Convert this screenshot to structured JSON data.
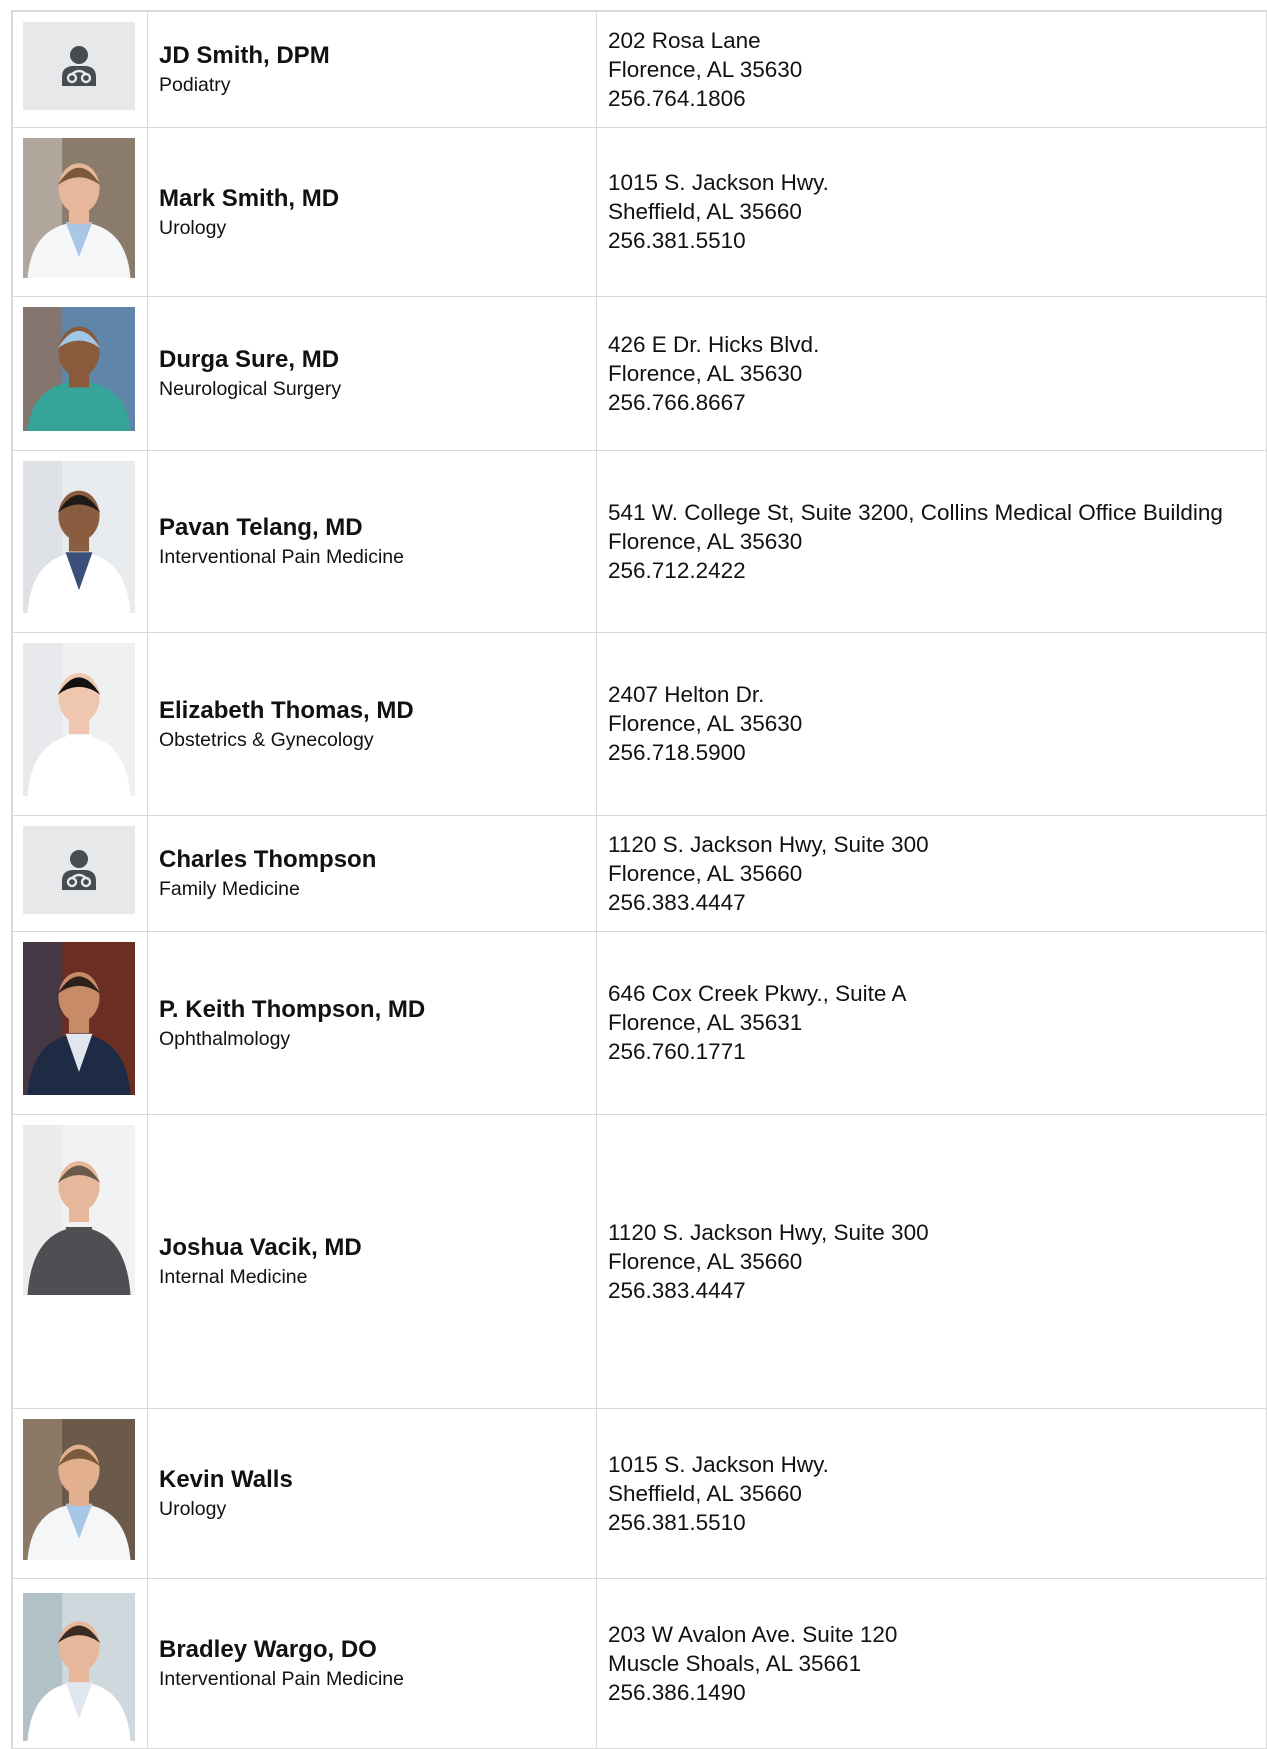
{
  "doctors": [
    {
      "name": "JD Smith, DPM",
      "specialty": "Podiatry",
      "address": "202 Rosa Lane",
      "city": "Florence, AL 35630",
      "phone": "256.764.1806",
      "photo": "placeholder-doctor-icon"
    },
    {
      "name": "Mark Smith, MD",
      "specialty": "Urology",
      "address": "1015 S. Jackson Hwy.",
      "city": "Sheffield, AL 35660",
      "phone": "256.381.5510",
      "photo": "portrait"
    },
    {
      "name": "Durga Sure, MD",
      "specialty": "Neurological Surgery",
      "address": "426 E Dr. Hicks Blvd.",
      "city": "Florence, AL 35630",
      "phone": "256.766.8667",
      "photo": "portrait"
    },
    {
      "name": "Pavan Telang, MD",
      "specialty": "Interventional Pain Medicine",
      "address": "541 W. College St, Suite 3200, Collins Medical Office Building",
      "city": "Florence, AL 35630",
      "phone": "256.712.2422",
      "photo": "portrait"
    },
    {
      "name": "Elizabeth Thomas, MD",
      "specialty": "Obstetrics & Gynecology",
      "address": "2407 Helton Dr.",
      "city": "Florence, AL 35630",
      "phone": "256.718.5900",
      "photo": "portrait"
    },
    {
      "name": "Charles Thompson",
      "specialty": "Family Medicine",
      "address": "1120 S. Jackson Hwy, Suite 300",
      "city": "Florence, AL 35660",
      "phone": "256.383.4447",
      "photo": "placeholder-doctor-icon"
    },
    {
      "name": "P. Keith Thompson, MD",
      "specialty": "Ophthalmology",
      "address": "646 Cox Creek Pkwy., Suite A",
      "city": "Florence, AL 35631",
      "phone": "256.760.1771",
      "photo": "portrait"
    },
    {
      "name": "Joshua Vacik, MD",
      "specialty": "Internal Medicine",
      "address": "1120 S. Jackson Hwy, Suite 300",
      "city": "Florence, AL 35660",
      "phone": "256.383.4447",
      "photo": "portrait"
    },
    {
      "name": "Kevin Walls",
      "specialty": "Urology",
      "address": "1015 S. Jackson Hwy.",
      "city": "Sheffield, AL 35660",
      "phone": "256.381.5510",
      "photo": "portrait"
    },
    {
      "name": "Bradley Wargo, DO",
      "specialty": "Interventional Pain Medicine",
      "address": "203 W Avalon Ave. Suite 120",
      "city": "Muscle Shoals, AL 35661",
      "phone": "256.386.1490",
      "photo": "portrait"
    }
  ],
  "colors": {
    "border": "#d9d9d9",
    "placeholder_bg": "#e7e8ea",
    "placeholder_icon": "#474b52",
    "text": "#111111"
  }
}
